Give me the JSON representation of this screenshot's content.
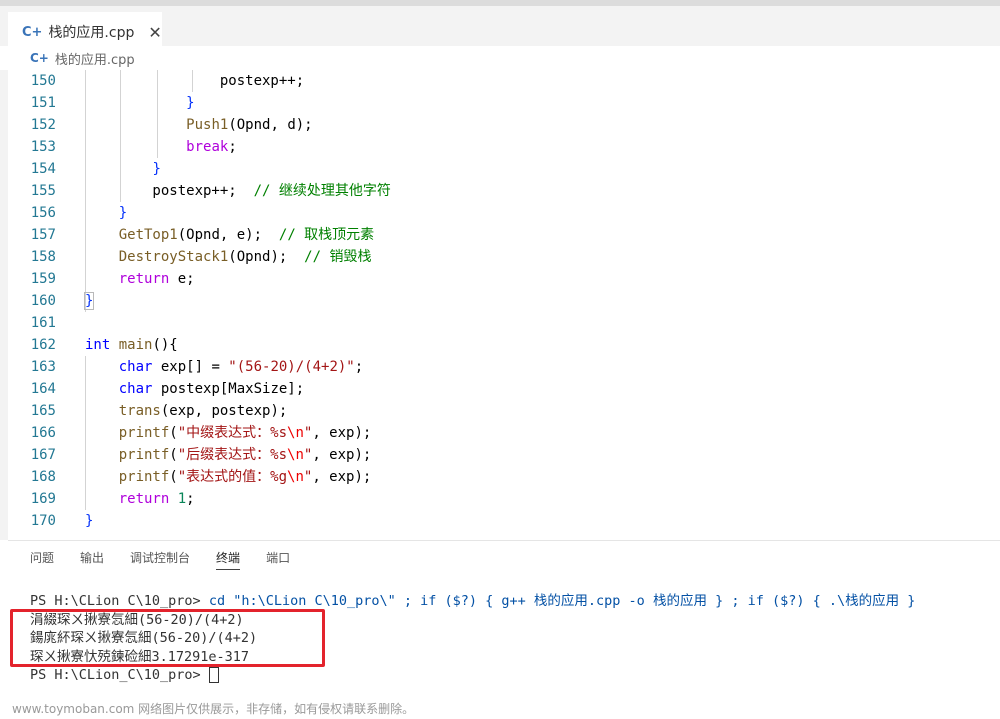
{
  "tab": {
    "icon": "c++-file-icon",
    "title": "栈的应用.cpp",
    "close": "✕"
  },
  "breadcrumb": {
    "file": "栈的应用.cpp"
  },
  "code_lines": [
    {
      "n": "150",
      "html": "                <span>postexp++;</span>"
    },
    {
      "n": "151",
      "html": "            <span class='br'>}</span>"
    },
    {
      "n": "152",
      "html": "            <span class='fn'>Push1</span>(Opnd, d);"
    },
    {
      "n": "153",
      "html": "            <span class='kp'>break</span>;"
    },
    {
      "n": "154",
      "html": "        <span class='br'>}</span>"
    },
    {
      "n": "155",
      "html": "        postexp++;  <span class='cm'>// 继续处理其他字符</span>"
    },
    {
      "n": "156",
      "html": "    <span class='br'>}</span>"
    },
    {
      "n": "157",
      "html": "    <span class='fn'>GetTop1</span>(Opnd, e);  <span class='cm'>// 取栈顶元素</span>"
    },
    {
      "n": "158",
      "html": "    <span class='fn'>DestroyStack1</span>(Opnd);  <span class='cm'>// 销毁栈</span>"
    },
    {
      "n": "159",
      "html": "    <span class='kp'>return</span> e;"
    },
    {
      "n": "160",
      "html": "<span class='brh'>}</span>"
    },
    {
      "n": "161",
      "html": ""
    },
    {
      "n": "162",
      "html": "<span class='kw'>int</span> <span class='fn'>main</span>(){"
    },
    {
      "n": "163",
      "html": "    <span class='kw'>char</span> exp[] = <span class='str'>\"(56-20)/(4+2)\"</span>;"
    },
    {
      "n": "164",
      "html": "    <span class='kw'>char</span> postexp[MaxSize];"
    },
    {
      "n": "165",
      "html": "    <span class='fn'>trans</span>(exp, postexp);"
    },
    {
      "n": "166",
      "html": "    <span class='fn'>printf</span>(<span class='str'>\"中缀表达式：%s<span class='esc'>\\n</span>\"</span>, exp);"
    },
    {
      "n": "167",
      "html": "    <span class='fn'>printf</span>(<span class='str'>\"后缀表达式：%s<span class='esc'>\\n</span>\"</span>, exp);"
    },
    {
      "n": "168",
      "html": "    <span class='fn'>printf</span>(<span class='str'>\"表达式的值：%g<span class='esc'>\\n</span>\"</span>, exp);"
    },
    {
      "n": "169",
      "html": "    <span class='kp'>return</span> <span class='num'>1</span>;"
    },
    {
      "n": "170",
      "html": "<span class='br'>}</span>"
    }
  ],
  "panel": {
    "tabs": [
      {
        "label": "问题",
        "active": false
      },
      {
        "label": "输出",
        "active": false
      },
      {
        "label": "调试控制台",
        "active": false
      },
      {
        "label": "终端",
        "active": true
      },
      {
        "label": "端口",
        "active": false
      }
    ]
  },
  "terminal": {
    "prompt1": "PS H:\\CLion C\\10_pro> ",
    "cmd": "cd \"h:\\CLion C\\10_pro\\\" ; if ($?) { g++ 栈的应用.cpp -o 栈的应用 } ; if ($?) { .\\栈的应用 }",
    "out1": "涓綴琛ㄨ揪寮忥細(56-20)/(4+2)",
    "out2": "鍚庣紑琛ㄨ揪寮忥細(56-20)/(4+2)",
    "out3": "琛ㄨ揪寮忕殑鍊硷細3.17291e-317",
    "prompt2": "PS H:\\CLion_C\\10_pro> "
  },
  "watermark": "www.toymoban.com 网络图片仅供展示，非存储，如有侵权请联系删除。",
  "colors": {
    "highlight": "#e3232c",
    "line_number": "#237893",
    "keyword": "#0000ff",
    "comment": "#008000",
    "string": "#a31515"
  }
}
